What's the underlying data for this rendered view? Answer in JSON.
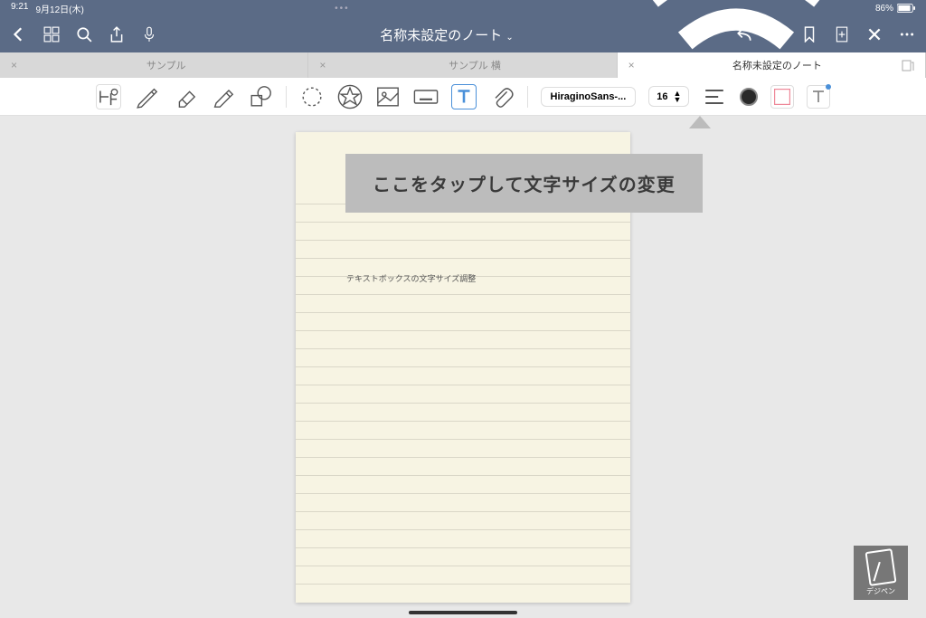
{
  "status": {
    "time": "9:21",
    "date": "9月12日(木)",
    "battery": "86%"
  },
  "nav": {
    "title": "名称未設定のノート"
  },
  "tabs": [
    {
      "label": "サンプル",
      "active": false
    },
    {
      "label": "サンプル 横",
      "active": false
    },
    {
      "label": "名称未設定のノート",
      "active": true
    }
  ],
  "toolbar": {
    "font_name": "HiraginoSans-...",
    "font_size": "16",
    "icons": {
      "pen": "pen-icon",
      "eraser": "eraser-icon",
      "highlighter": "highlighter-icon",
      "shapes": "shapes-icon",
      "lasso": "lasso-icon",
      "stamp": "stamp-icon",
      "image": "image-icon",
      "keyboard": "keyboard-icon",
      "text": "text-icon",
      "link": "link-icon"
    }
  },
  "paper": {
    "text": "テキストボックスの文字サイズ調整"
  },
  "callout": {
    "text": "ここをタップして文字サイズの変更"
  },
  "logo": {
    "label": "デジペン"
  }
}
